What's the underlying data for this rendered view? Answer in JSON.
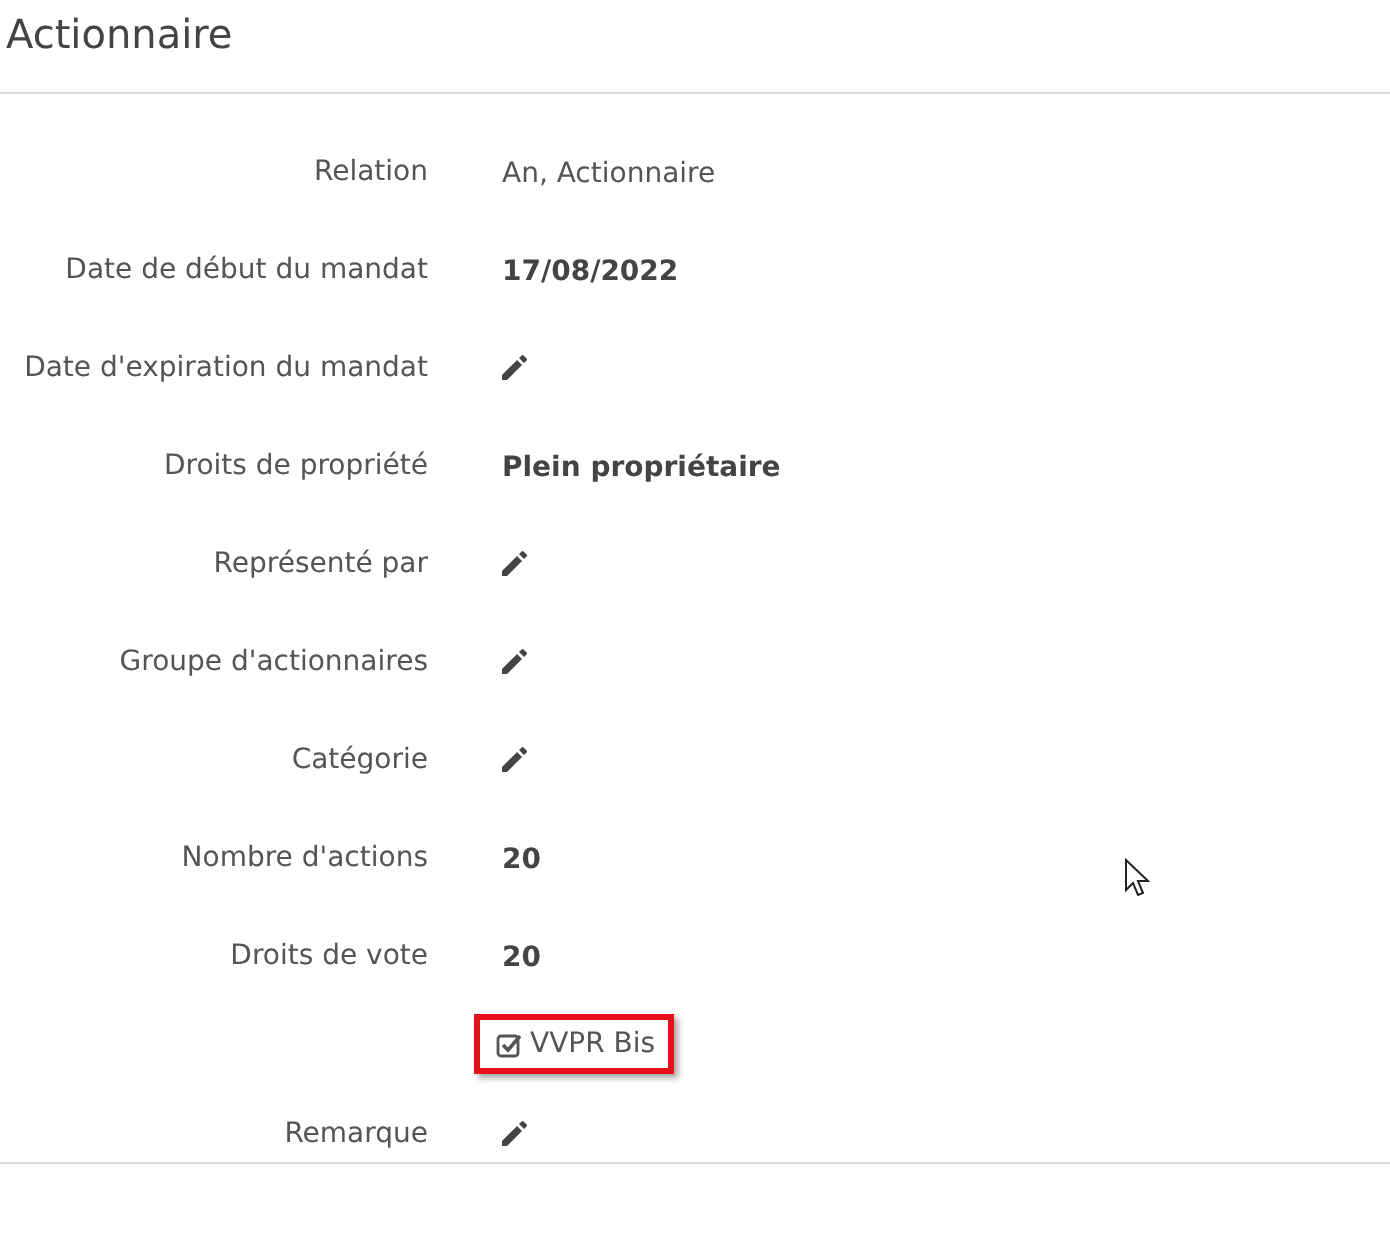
{
  "title": "Actionnaire",
  "fields": [
    {
      "label": "Relation",
      "kind": "text",
      "value": "An, Actionnaire"
    },
    {
      "label": "Date de début du mandat",
      "kind": "bold",
      "value": "17/08/2022"
    },
    {
      "label": "Date d'expiration du mandat",
      "kind": "edit"
    },
    {
      "label": "Droits de propriété",
      "kind": "bold",
      "value": "Plein propriétaire"
    },
    {
      "label": "Représenté par",
      "kind": "edit"
    },
    {
      "label": "Groupe d'actionnaires",
      "kind": "edit"
    },
    {
      "label": "Catégorie",
      "kind": "edit"
    },
    {
      "label": "Nombre d'actions",
      "kind": "bold",
      "value": "20"
    },
    {
      "label": "Droits de vote",
      "kind": "bold",
      "value": "20"
    },
    {
      "kind": "checkbox",
      "value": "VVPR Bis",
      "checked": true,
      "highlighted": true
    },
    {
      "label": "Remarque",
      "kind": "edit"
    }
  ]
}
